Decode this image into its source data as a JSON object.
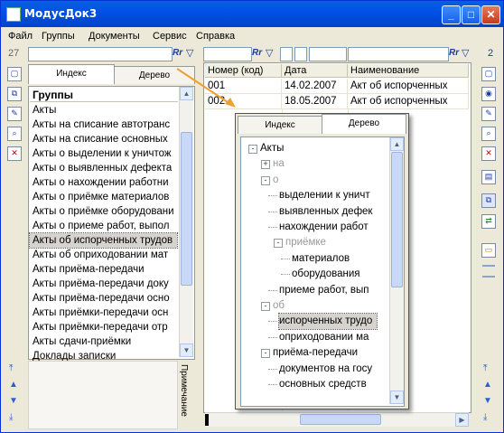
{
  "window": {
    "title": "МодусДок3"
  },
  "menu": [
    "Файл",
    "Группы",
    "Документы",
    "Сервис",
    "Справка"
  ],
  "left_counter": "27",
  "right_counter": "2",
  "filter_label": "Rr",
  "left_panel": {
    "tabs": [
      "Индекс",
      "Дерево"
    ],
    "list_header": "Группы",
    "items": [
      "Акты",
      "Акты на списание автотранс",
      "Акты на списание основных",
      "Акты о выделении к уничтож",
      "Акты о выявленных дефекта",
      "Акты о нахождении работни",
      "Акты о приёмке материалов",
      "Акты о приёмке оборудовани",
      "Акты о приеме работ, выпол",
      "Акты об испорченных трудов",
      "Акты об оприходовании мат",
      "Акты приёма-передачи",
      "Акты приёма-передачи доку",
      "Акты приёма-передачи осно",
      "Акты приёмки-передачи осн",
      "Акты приёмки-передачи отр",
      "Акты сдачи-приёмки",
      "Доклады записки"
    ],
    "selected_index": 9,
    "note_label": "Примечание"
  },
  "grid": {
    "columns": [
      "Номер (код)",
      "Дата",
      "Наименование"
    ],
    "rows": [
      [
        "001",
        "14.02.2007",
        "Акт об испорченных"
      ],
      [
        "002",
        "18.05.2007",
        "Акт об испорченных"
      ]
    ]
  },
  "popup": {
    "tabs": [
      "Индекс",
      "Дерево"
    ],
    "tree": [
      {
        "text": "Акты",
        "indent": 0,
        "box": "-",
        "dim": false
      },
      {
        "text": "на",
        "indent": 1,
        "box": "+",
        "dim": true
      },
      {
        "text": "о",
        "indent": 1,
        "box": "-",
        "dim": true
      },
      {
        "text": "выделении к уничт",
        "indent": 2,
        "box": "",
        "dim": false
      },
      {
        "text": "выявленных дефек",
        "indent": 2,
        "box": "",
        "dim": false
      },
      {
        "text": "нахождении работ",
        "indent": 2,
        "box": "",
        "dim": false
      },
      {
        "text": "приёмке",
        "indent": 2,
        "box": "-",
        "dim": true
      },
      {
        "text": "материалов",
        "indent": 3,
        "box": "",
        "dim": false
      },
      {
        "text": "оборудования",
        "indent": 3,
        "box": "",
        "dim": false
      },
      {
        "text": "приеме работ, вып",
        "indent": 2,
        "box": "",
        "dim": false
      },
      {
        "text": "об",
        "indent": 1,
        "box": "-",
        "dim": true
      },
      {
        "text": "испорченных трудо",
        "indent": 2,
        "box": "",
        "dim": false,
        "selected": true
      },
      {
        "text": "оприходовании ма",
        "indent": 2,
        "box": "",
        "dim": false
      },
      {
        "text": "приёма-передачи",
        "indent": 1,
        "box": "-",
        "dim": false
      },
      {
        "text": "документов на госу",
        "indent": 2,
        "box": "",
        "dim": false
      },
      {
        "text": "основных средств",
        "indent": 2,
        "box": "",
        "dim": false
      }
    ]
  },
  "colors": {
    "title_bar": "#0a5fe0",
    "selection": "#d6d3ce",
    "accent": "#1c3a9c"
  }
}
